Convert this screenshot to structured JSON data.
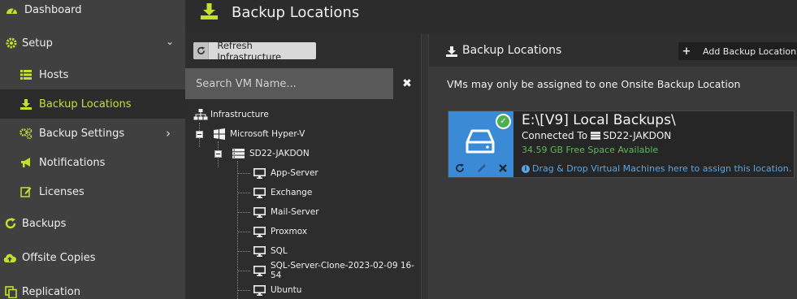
{
  "colors": {
    "accent": "#c5e02c",
    "panel": "#3a3a3a",
    "sidebar": "#404040",
    "card_blue": "#3b8ad6",
    "success": "#5cb85c",
    "info": "#5aa6e6"
  },
  "sidebar": {
    "items": [
      {
        "label": "Dashboard",
        "icon": "dashboard-icon"
      },
      {
        "label": "Setup",
        "icon": "gear-icon",
        "chevron": "⌄"
      },
      {
        "label": "Hosts",
        "icon": "list-icon"
      },
      {
        "label": "Backup Locations",
        "icon": "download-icon",
        "active": true
      },
      {
        "label": "Backup Settings",
        "icon": "gears-icon",
        "chevron": "›"
      },
      {
        "label": "Notifications",
        "icon": "megaphone-icon"
      },
      {
        "label": "Licenses",
        "icon": "edit-icon"
      },
      {
        "label": "Backups",
        "icon": "refresh-icon"
      },
      {
        "label": "Offsite Copies",
        "icon": "cloud-upload-icon"
      },
      {
        "label": "Replication",
        "icon": "copy-icon"
      }
    ]
  },
  "header": {
    "title": "Backup Locations",
    "icon": "download-icon"
  },
  "tree_panel": {
    "refresh_label": "Refresh Infrastructure",
    "search_placeholder": "Search VM Name...",
    "clear": "✖",
    "root": "Infrastructure",
    "hypervisor": "Microsoft Hyper-V",
    "host": "SD22-JAKDON",
    "vms": [
      "App-Server",
      "Exchange",
      "Mail-Server",
      "Proxmox",
      "SQL",
      "SQL-Server-Clone-2023-02-09 16-54",
      "Ubuntu"
    ]
  },
  "right_panel": {
    "title": "Backup Locations",
    "add_label": "Add Backup Location",
    "info": "VMs may only be assigned to one Onsite Backup Location",
    "card": {
      "title": "E:\\[V9] Local Backups\\",
      "connected_prefix": "Connected To",
      "host": "SD22-JAKDON",
      "free_space": "34.59 GB Free Space Available",
      "hint": "Drag & Drop Virtual Machines here to assign this location."
    }
  }
}
